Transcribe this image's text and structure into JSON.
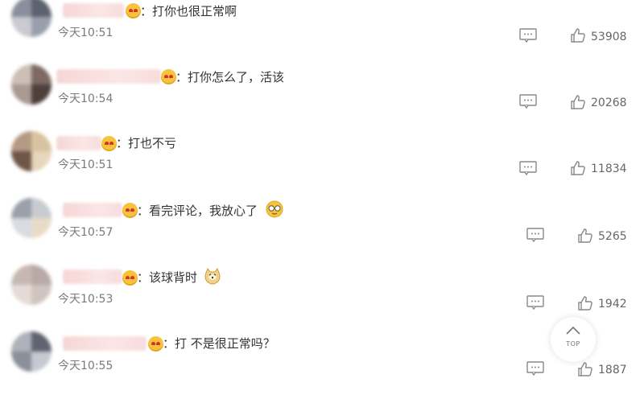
{
  "comments": [
    {
      "text": "：打你也很正常啊",
      "time": "今天10:51",
      "likes": "53908"
    },
    {
      "text": "：打你怎么了，活该",
      "time": "今天10:54",
      "likes": "20268"
    },
    {
      "text": "：打也不亏",
      "time": "今天10:51",
      "likes": "11834"
    },
    {
      "text": "：看完评论，我放心了",
      "time": "今天10:57",
      "likes": "5265"
    },
    {
      "text": "：该球背时",
      "time": "今天10:53",
      "likes": "1942"
    },
    {
      "text": "：打 不是很正常吗？",
      "time": "今天10:55",
      "likes": "1887"
    }
  ],
  "back_to_top": "TOP",
  "colors": {
    "emoji": "#f6c33d",
    "name_blur": "#f6d6d6",
    "icon": "#888888"
  }
}
